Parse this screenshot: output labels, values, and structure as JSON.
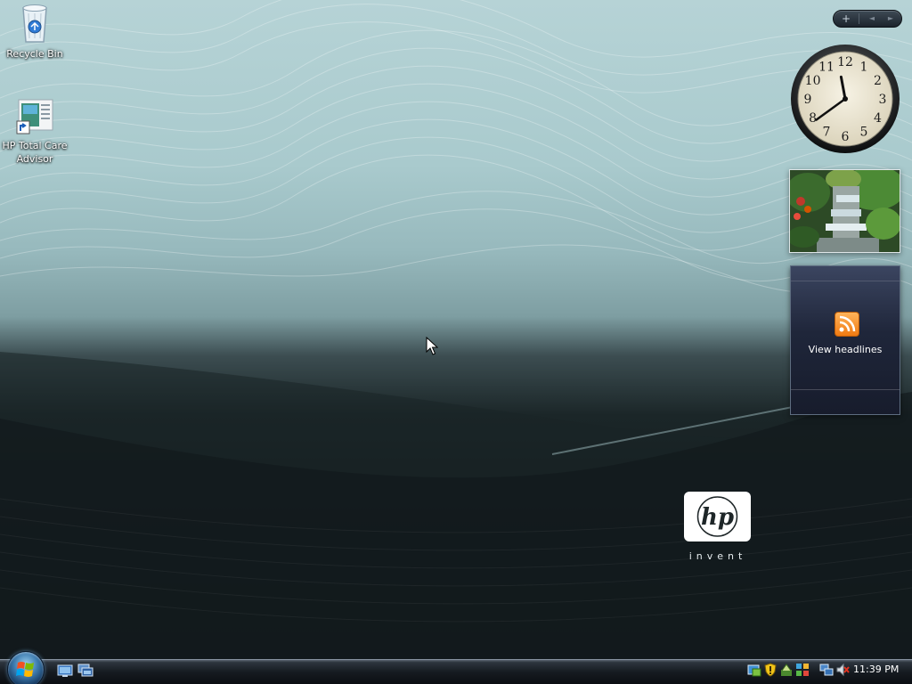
{
  "desktop": {
    "icons": [
      {
        "label": "Recycle Bin",
        "icon": "recycle-bin-icon"
      },
      {
        "label": "HP Total Care Advisor",
        "icon": "hp-total-care-advisor-icon"
      }
    ],
    "brand": {
      "logo_text": "hp",
      "tagline": "invent"
    }
  },
  "sidebar": {
    "controls": {
      "add": "+",
      "prev": "◄",
      "next": "►"
    },
    "clock": {
      "numerals": [
        "12",
        "1",
        "2",
        "3",
        "4",
        "5",
        "6",
        "7",
        "8",
        "9",
        "10",
        "11"
      ],
      "time": "11:39"
    },
    "slideshow": {
      "icon": "waterfall-photo"
    },
    "feed": {
      "label": "View headlines",
      "icon": "rss-icon"
    }
  },
  "taskbar": {
    "start_icon": "windows-start-orb",
    "quick_launch": [
      "show-desktop-icon",
      "switch-windows-icon"
    ],
    "tray_icons": [
      "hp-update-icon",
      "security-shield-icon",
      "windows-defender-icon",
      "network-sharing-icon",
      "network-icon",
      "volume-muted-icon"
    ],
    "clock": "11:39 PM"
  },
  "colors": {
    "wallpaper_top": "#b6d3d6",
    "wallpaper_bottom": "#0f1517",
    "taskbar": "#161b21",
    "feed_gadget": "#1f263a",
    "rss_orange": "#f07a12"
  }
}
